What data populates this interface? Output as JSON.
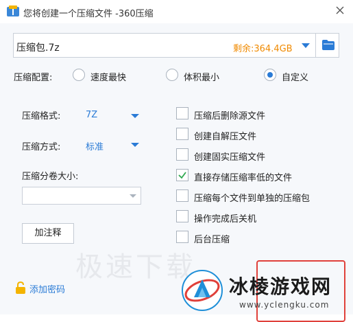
{
  "window": {
    "title": "您将创建一个压缩文件 -360压缩"
  },
  "path": {
    "filename": "压缩包.7z",
    "free_space": "剩余:364.4GB"
  },
  "config": {
    "label": "压缩配置:",
    "options": [
      {
        "label": "速度最快",
        "selected": false
      },
      {
        "label": "体积最小",
        "selected": false
      },
      {
        "label": "自定义",
        "selected": true
      }
    ]
  },
  "left": {
    "format_label": "压缩格式:",
    "format_value": "7Z",
    "method_label": "压缩方式:",
    "method_value": "标准",
    "split_label": "压缩分卷大小:",
    "split_value": "",
    "comment_button": "加注释"
  },
  "checkboxes": [
    {
      "label": "压缩后删除源文件",
      "checked": false
    },
    {
      "label": "创建自解压文件",
      "checked": false
    },
    {
      "label": "创建固实压缩文件",
      "checked": false
    },
    {
      "label": "直接存储压缩率低的文件",
      "checked": true
    },
    {
      "label": "压缩每个文件到单独的压缩包",
      "checked": false
    },
    {
      "label": "操作完成后关机",
      "checked": false
    },
    {
      "label": "后台压缩",
      "checked": false
    }
  ],
  "footer": {
    "password_link": "添加密码"
  },
  "watermark": {
    "text": "极速下载"
  },
  "brand": {
    "name": "冰棱游戏网",
    "url": "www.yclengku.com"
  },
  "colors": {
    "accent": "#2a7bd6",
    "free_space": "#f08a00",
    "check": "#2fa84f",
    "highlight_frame": "#e0403a"
  }
}
